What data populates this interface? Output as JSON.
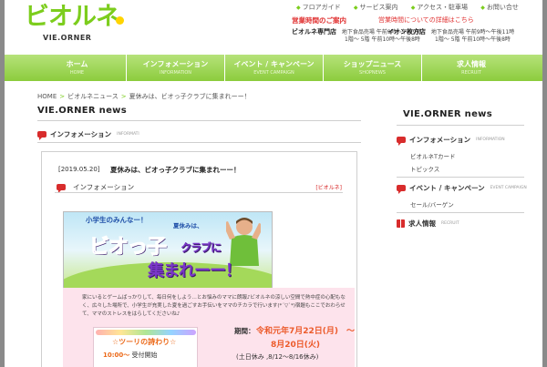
{
  "header": {
    "logo_text": "ビオルネ",
    "logo_sub": "VIE.ORNER",
    "top_links": [
      "フロアガイド",
      "サービス案内",
      "アクセス・駐車場",
      "お問い合せ"
    ],
    "hours_title": "営業時間のご案内",
    "hours_notice": "営業時間についての詳細はこちら",
    "stores": [
      {
        "name": "ビオルネ専門店",
        "line1": "地下食品売場 午前9時〜午後9時",
        "line2": "1階〜 5階 午前10時〜午後8時"
      },
      {
        "name": "イオン枚方店",
        "line1": "地下食品売場 午前9時〜午後11時",
        "line2": "1階〜 5階 午前10時〜午後8時"
      }
    ]
  },
  "nav": [
    {
      "jp": "ホーム",
      "en": "HOME"
    },
    {
      "jp": "インフォメーション",
      "en": "INFORMATION"
    },
    {
      "jp": "イベント / キャンペーン",
      "en": "EVENT CAMPAIGN"
    },
    {
      "jp": "ショップニュース",
      "en": "SHOPNEWS"
    },
    {
      "jp": "求人情報",
      "en": "RECRUIT"
    }
  ],
  "breadcrumb": [
    "HOME",
    "ビオルネニュース",
    "夏休みは、ビオっ子クラブに集まれーー！"
  ],
  "main": {
    "heading": "VIE.ORNER news",
    "section": {
      "jp": "インフォメーション",
      "en": "INFORMATI"
    }
  },
  "sidebar": {
    "heading": "VIE.ORNER news",
    "sections": [
      {
        "jp": "インフォメーション",
        "en": "INFORMATION",
        "links": [
          "ビオルネTカード",
          "トピックス"
        ]
      },
      {
        "jp": "イベント / キャンペーン",
        "en": "EVENT CAMPAIGN",
        "links": [
          "セール/バーゲン"
        ]
      },
      {
        "jp": "求人情報",
        "en": "RECRUIT",
        "links": []
      }
    ]
  },
  "article": {
    "date": "[2019.05.20]",
    "title": "夏休みは、ビオっ子クラブに集まれーー！",
    "category": "インフォメーション",
    "tag": "[ビオルネ]",
    "banner": {
      "top_line1": "小学生のみんなー！",
      "top_line2": "夏休みは、",
      "big_line1": "ビオっ子",
      "big_line1_small": "クラブに",
      "big_line2": "集まれーー！"
    },
    "body": "家にいるとゲームばっかりして、毎日何をしよう…とお悩みのママに朗報♪ビオルネの涼しい空間で熱中症の心配もなく、広々した場所で、小学生が充実した夏を過ごすお手伝いをママのチカラで行います(*´▽`*)宿題もここでおわらせて、ママのストレスをはらしてくださいね♪",
    "period_label": "期間：",
    "period_start": "令和元年7月22日(月)　～",
    "period_end": "8月20日(火)",
    "period_note": "(土日休み ,8/12～8/16休み)",
    "card_title": "☆ツーリの詩わり☆",
    "card_time": "10:00〜",
    "card_text": "受付開始"
  }
}
